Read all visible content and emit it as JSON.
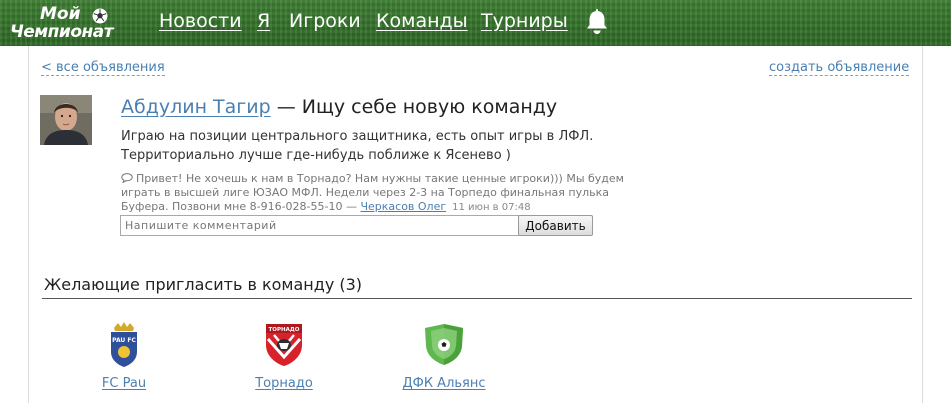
{
  "header": {
    "logo": {
      "line1": "Мой",
      "line2": "Чемпионат"
    },
    "nav": [
      {
        "label": "Новости"
      },
      {
        "label": "Я"
      },
      {
        "label": "Игроки"
      },
      {
        "label": "Команды"
      },
      {
        "label": "Турниры"
      }
    ],
    "notifications_icon": "bell-icon",
    "colors": {
      "header_green": "#3a7a2f",
      "link_blue": "#4a7fb2"
    }
  },
  "links": {
    "back": "< все объявления",
    "create": "создать объявление"
  },
  "post": {
    "author": "Абдулин Тагир",
    "title_suffix": " — Ищу себе новую команду",
    "body_line1": "Играю на позиции центрального защитника, есть опыт игры в ЛФЛ.",
    "body_line2": "Территориально лучше где-нибудь поближе к Ясенево )",
    "comment": {
      "icon": "speech-bubble-icon",
      "text": "Привет! Не хочешь к нам в Торнадо? Нам нужны такие ценные игроки))) Мы будем играть в высшей лиге ЮЗАО МФЛ. Недели через 2-3 на Торпедо финальная пулька Буфера. Позвони мне 8-916-028-55-10 — ",
      "author": "Черкасов Олег",
      "date": "11 июн в 07:48"
    },
    "comment_input": {
      "placeholder": "Напишите комментарий",
      "value": ""
    },
    "add_button": "Добавить"
  },
  "invites": {
    "title": "Желающие пригласить в команду (3)",
    "teams": [
      {
        "name": "FC Pau",
        "crest": "fc-pau-crest"
      },
      {
        "name": "Торнадо",
        "crest": "tornado-crest"
      },
      {
        "name": "ДФК Альянс",
        "crest": "dfk-alyans-crest"
      }
    ]
  }
}
